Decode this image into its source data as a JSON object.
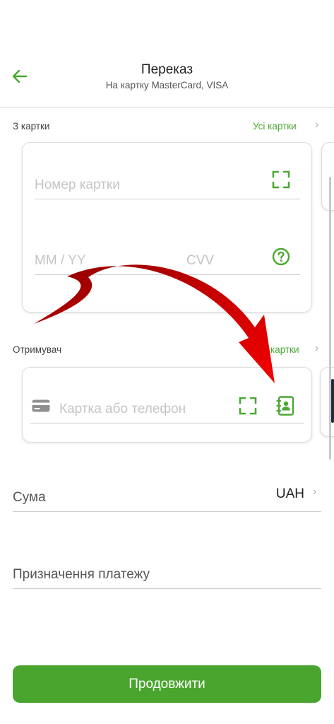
{
  "header": {
    "title": "Переказ",
    "subtitle": "На картку MasterCard, VISA",
    "back_icon": "arrow-left-icon"
  },
  "from_section": {
    "label": "З картки",
    "link": "Усі картки",
    "card_number_placeholder": "Номер картки",
    "expiry_placeholder": "MM / YY",
    "cvv_placeholder": "CVV"
  },
  "recipient_section": {
    "label": "Отримувач",
    "link": "картки",
    "input_placeholder": "Картка або телефон"
  },
  "amount": {
    "label": "Сума",
    "currency": "UAH"
  },
  "purpose": {
    "label": "Призначення платежу"
  },
  "continue_button": "Продовжити",
  "colors": {
    "accent_green": "#4aa52e",
    "annotation_arrow": "#d40000"
  }
}
